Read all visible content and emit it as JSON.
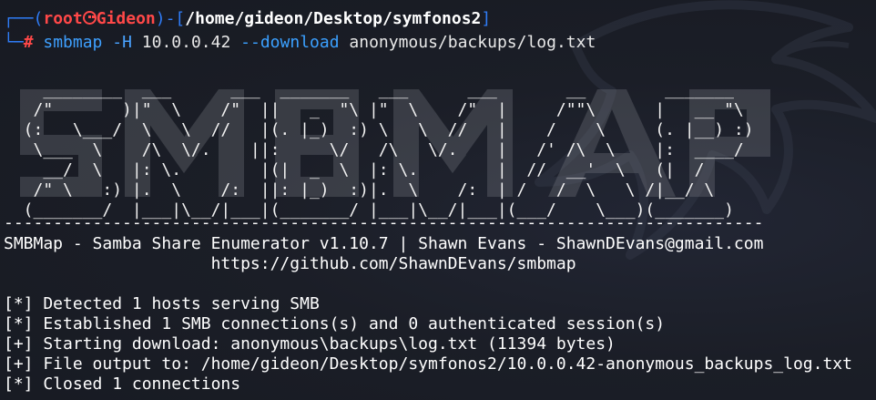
{
  "prompt": {
    "user": "root",
    "host": "Gideon",
    "cwd": "/home/gideon/Desktop/symfonos2",
    "symbol": "#"
  },
  "command": {
    "program": "smbmap",
    "flag_host": "-H",
    "host_ip": "10.0.0.42",
    "flag_download": "--download",
    "target": "anonymous/backups/log.txt"
  },
  "banner": {
    "ascii_lines": [
      "    ________  ___      ___  _______   ___      ___       __        _______",
      "   /\"       )|\"  \\    /\"  ||   _  \"\\ |\"  \\    /\"  |     /\"\"\\      |   __ \"\\",
      "  (:   \\___/  \\   \\  //   |(. |_)  :) \\   \\  //   |    /    \\     (. |__) :)",
      "   \\___  \\    /\\  \\/.    ||:     \\/   /\\   \\/.    |   /' /\\  \\    |:  ____/",
      "    __/  \\   |: \\.        |(|  _  \\  |: \\.        |  //  __'  \\   (|  /",
      "   /\" \\   :) |.  \\    /:  ||: |_)  :)|.  \\    /:  | /   /  \\   \\ /|__/ \\",
      "  (_______/  |___|\\__/|___|(_______/ |___|\\__/|___|(___/    \\___)(_______)"
    ],
    "separator": "-----------------------------------------------------------------------------",
    "title_line": "SMBMap - Samba Share Enumerator v1.10.7 | Shawn Evans - ShawnDEvans@gmail.com",
    "url_line": "                     https://github.com/ShawnDEvans/smbmap"
  },
  "output": [
    "[*] Detected 1 hosts serving SMB",
    "[*] Established 1 SMB connections(s) and 0 authenticated session(s)",
    "[+] Starting download: anonymous\\backups\\log.txt (11394 bytes)",
    "[+] File output to: /home/gideon/Desktop/symfonos2/10.0.0.42-anonymous_backups_log.txt",
    "[*] Closed 1 connections"
  ],
  "colors": {
    "background": "#1a1d26",
    "prompt_frame": "#2f7cf6",
    "prompt_user": "#ff4848",
    "command": "#3ea0ff",
    "text": "#ffffff"
  }
}
